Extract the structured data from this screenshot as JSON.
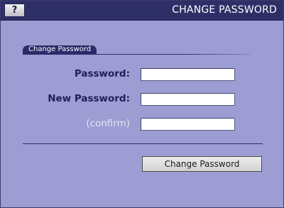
{
  "window": {
    "title": "CHANGE PASSWORD",
    "help_button": "?"
  },
  "section": {
    "tab_label": "Change Password"
  },
  "form": {
    "password_label": "Password:",
    "password_value": "",
    "new_password_label": "New Password:",
    "new_password_value": "",
    "confirm_label": "(confirm)",
    "confirm_value": "",
    "submit_label": "Change Password"
  },
  "colors": {
    "titlebar": "#2f2f68",
    "background": "#9d9dd4",
    "label_text": "#1e1e5a",
    "accent": "#2b2b6a"
  },
  "icons": {
    "help": "question-mark-icon"
  }
}
